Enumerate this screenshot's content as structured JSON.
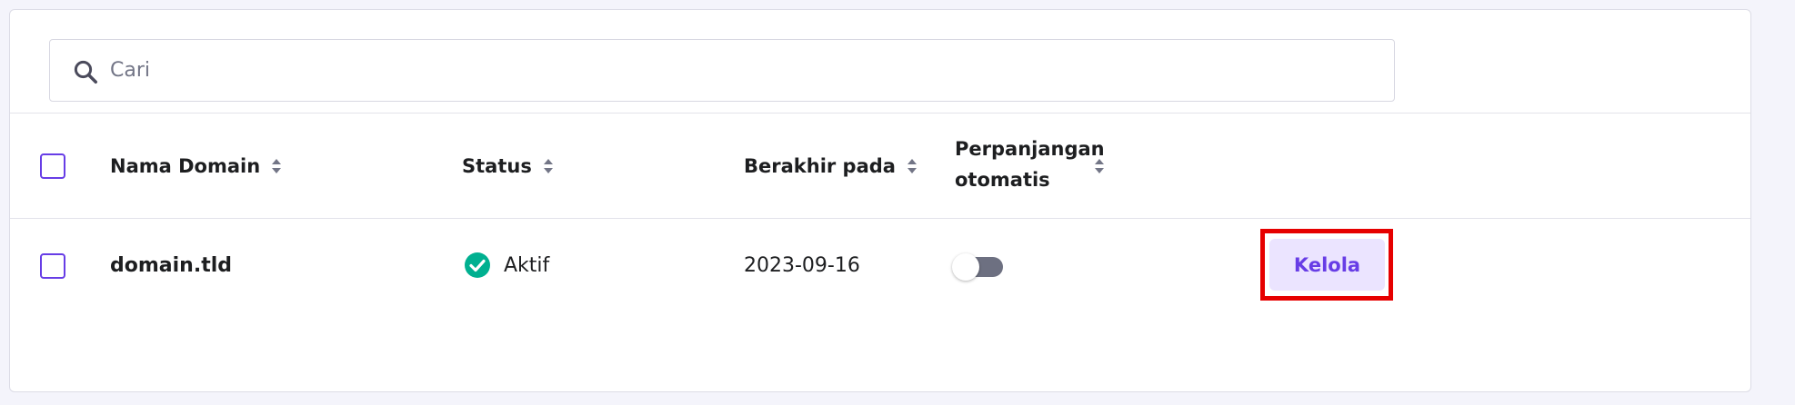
{
  "search": {
    "placeholder": "Cari",
    "value": ""
  },
  "table": {
    "headers": {
      "domain": "Nama Domain",
      "status": "Status",
      "expires": "Berakhir pada",
      "autorenew_line1": "Perpanjangan",
      "autorenew_line2": "otomatis"
    },
    "rows": [
      {
        "domain": "domain.tld",
        "status": "Aktif",
        "expires": "2023-09-16",
        "autorenew": false,
        "action_label": "Kelola"
      }
    ]
  },
  "colors": {
    "accent": "#673de6",
    "button_bg": "#ebe4ff",
    "status_success": "#00b090",
    "highlight": "#e60000"
  },
  "icons": {
    "search": "search-icon",
    "sort": "sort-icon",
    "status": "check-circle-icon"
  }
}
